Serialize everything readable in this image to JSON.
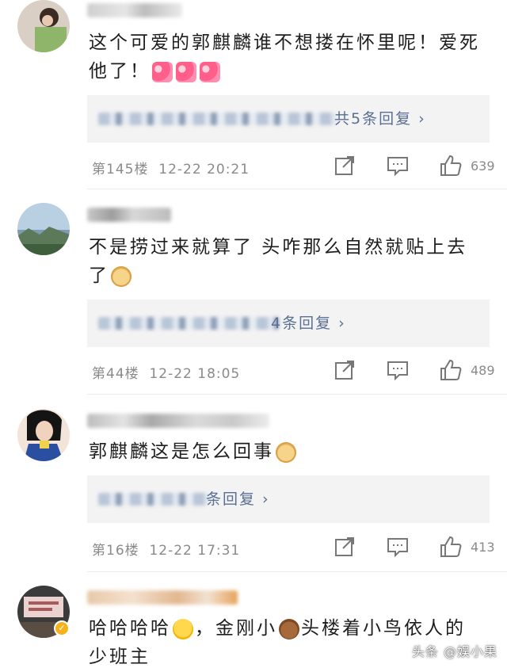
{
  "comments": [
    {
      "text": "这个可爱的郭麒麟谁不想搂在怀里呢！爱死他了！",
      "emojis": [
        "heart-eyes",
        "heart-eyes",
        "heart-eyes"
      ],
      "reply_link": "共5条回复 ›",
      "floor": "第145楼",
      "time": "12-22 20:21",
      "likes": "639"
    },
    {
      "text": "不是捞过来就算了 头咋那么自然就贴上去了",
      "emojis": [
        "doge"
      ],
      "reply_link": "4条回复 ›",
      "floor": "第44楼",
      "time": "12-22 18:05",
      "likes": "489"
    },
    {
      "text": "郭麒麟这是怎么回事",
      "emojis": [
        "doge"
      ],
      "reply_link": "条回复 ›",
      "floor": "第16楼",
      "time": "12-22 17:31",
      "likes": "413"
    },
    {
      "text_before": "哈哈哈哈",
      "text_mid": "，金刚小",
      "text_after": "头楼着小鸟依人的少班主",
      "emojis": [
        "laugh-cry",
        "bear"
      ]
    }
  ],
  "icons": {
    "share": "share-icon",
    "comment": "comment-icon",
    "like": "thumbs-up-icon",
    "verified": "verified-badge-icon"
  },
  "watermark": "头条 @娱小果"
}
